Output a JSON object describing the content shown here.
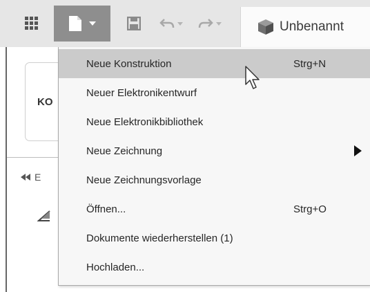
{
  "toolbar": {
    "icons": [
      "grid-icon",
      "file-icon",
      "save-icon",
      "undo-icon",
      "redo-icon"
    ],
    "document_tab": {
      "icon": "cube-icon",
      "title": "Unbenannt"
    }
  },
  "background": {
    "card_text": "KO",
    "collapse_icon": "double-left-arrow-icon",
    "collapse_text": "E",
    "angle_icon": "angle-icon"
  },
  "file_menu": {
    "items": [
      {
        "label": "Neue Konstruktion",
        "shortcut": "Strg+N",
        "highlighted": true
      },
      {
        "label": "Neuer Elektronikentwurf",
        "shortcut": ""
      },
      {
        "label": "Neue Elektronikbibliothek",
        "shortcut": ""
      },
      {
        "label": "Neue Zeichnung",
        "shortcut": "",
        "submenu": true
      },
      {
        "label": "Neue Zeichnungsvorlage",
        "shortcut": ""
      },
      {
        "label": "Öffnen...",
        "shortcut": "Strg+O"
      },
      {
        "label": "Dokumente wiederherstellen (1)",
        "shortcut": ""
      },
      {
        "label": "Hochladen...",
        "shortcut": ""
      }
    ]
  },
  "colors": {
    "toolbar_bg": "#e6e6e6",
    "active_button_bg": "#8e8e8e",
    "menu_bg": "#f7f7f7",
    "menu_highlight": "#cbcbcb"
  }
}
